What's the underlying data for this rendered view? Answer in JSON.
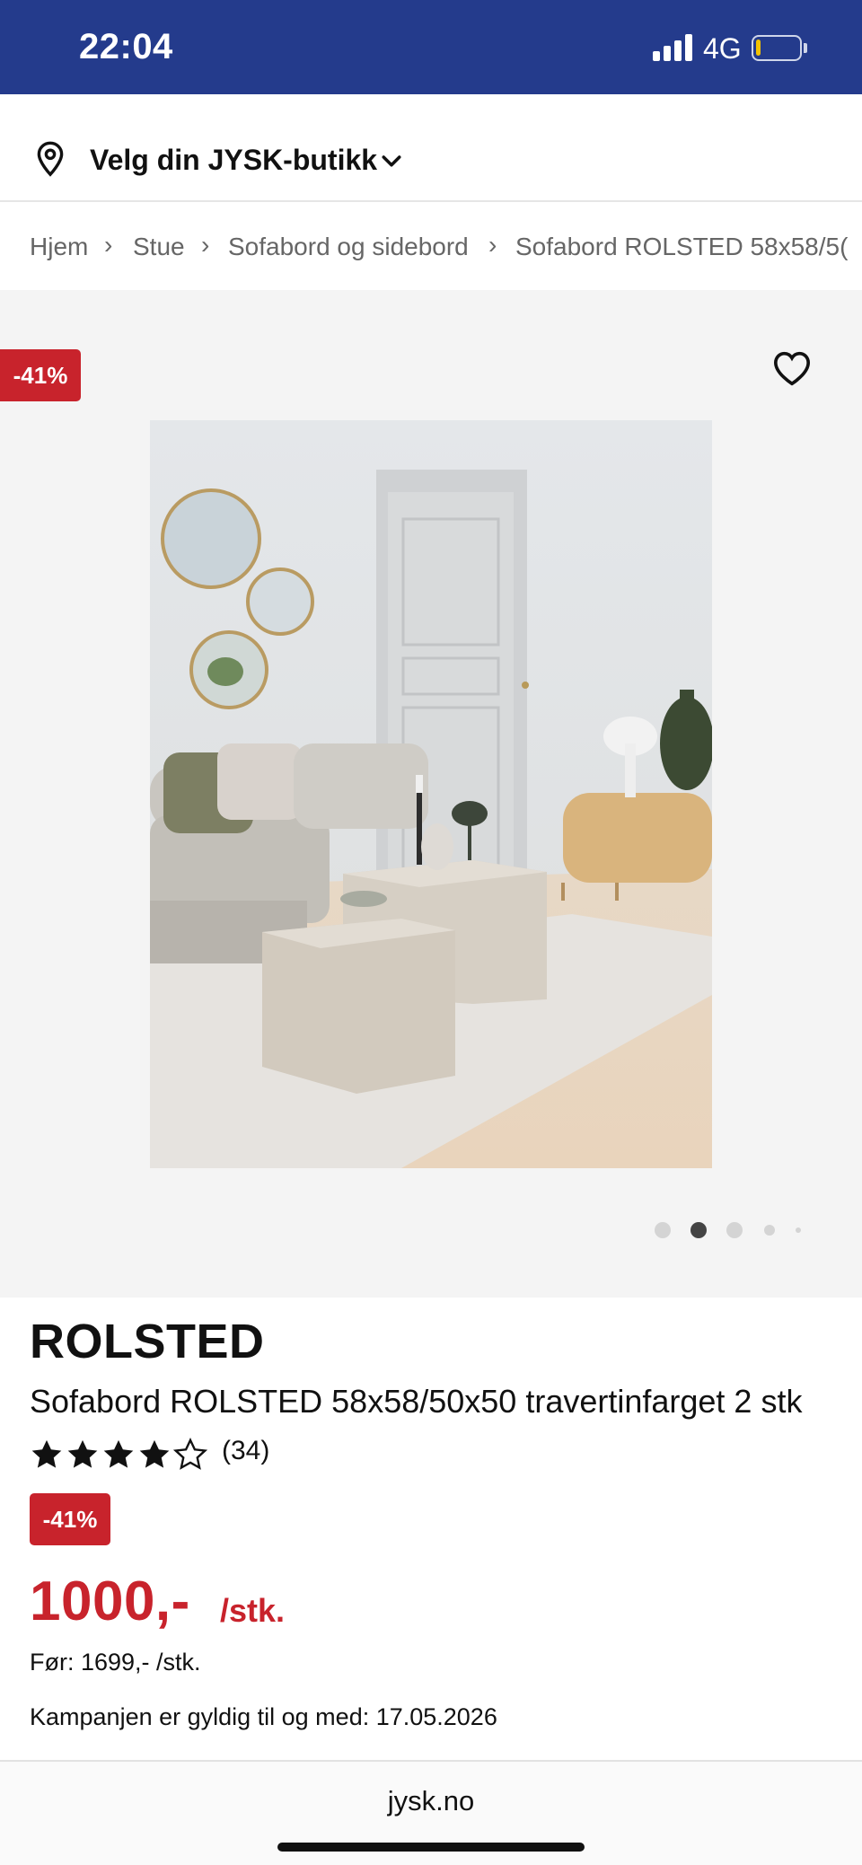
{
  "status_bar": {
    "time": "22:04",
    "network": "4G",
    "battery_level": 0.1,
    "battery_fill_color": "#f2c200",
    "background_color": "#243b8c"
  },
  "store_picker": {
    "label": "Velg din JYSK-butikk",
    "icon": "location-pin-icon"
  },
  "breadcrumb": {
    "items": [
      "Hjem",
      "Stue",
      "Sofabord og sidebord",
      "Sofabord ROLSTED 58x58/5("
    ],
    "separator": "›"
  },
  "gallery": {
    "discount_badge": "-41%",
    "favorite_icon": "heart-icon",
    "image_count": 5,
    "active_index": 1
  },
  "product": {
    "brand": "ROLSTED",
    "name": "Sofabord ROLSTED 58x58/50x50 travertinfarget 2 stk",
    "rating": 4,
    "rating_max": 5,
    "review_count": "(34)",
    "discount": "-41%",
    "price": "1000,-",
    "price_unit": "/stk.",
    "old_price": "Før: 1699,- /stk.",
    "campaign": "Kampanjen er gyldig til og med: 17.05.2026"
  },
  "browser": {
    "domain": "jysk.no"
  },
  "colors": {
    "sale_red": "#c8232c",
    "header_blue": "#243b8c",
    "gallery_bg": "#f4f4f4"
  }
}
